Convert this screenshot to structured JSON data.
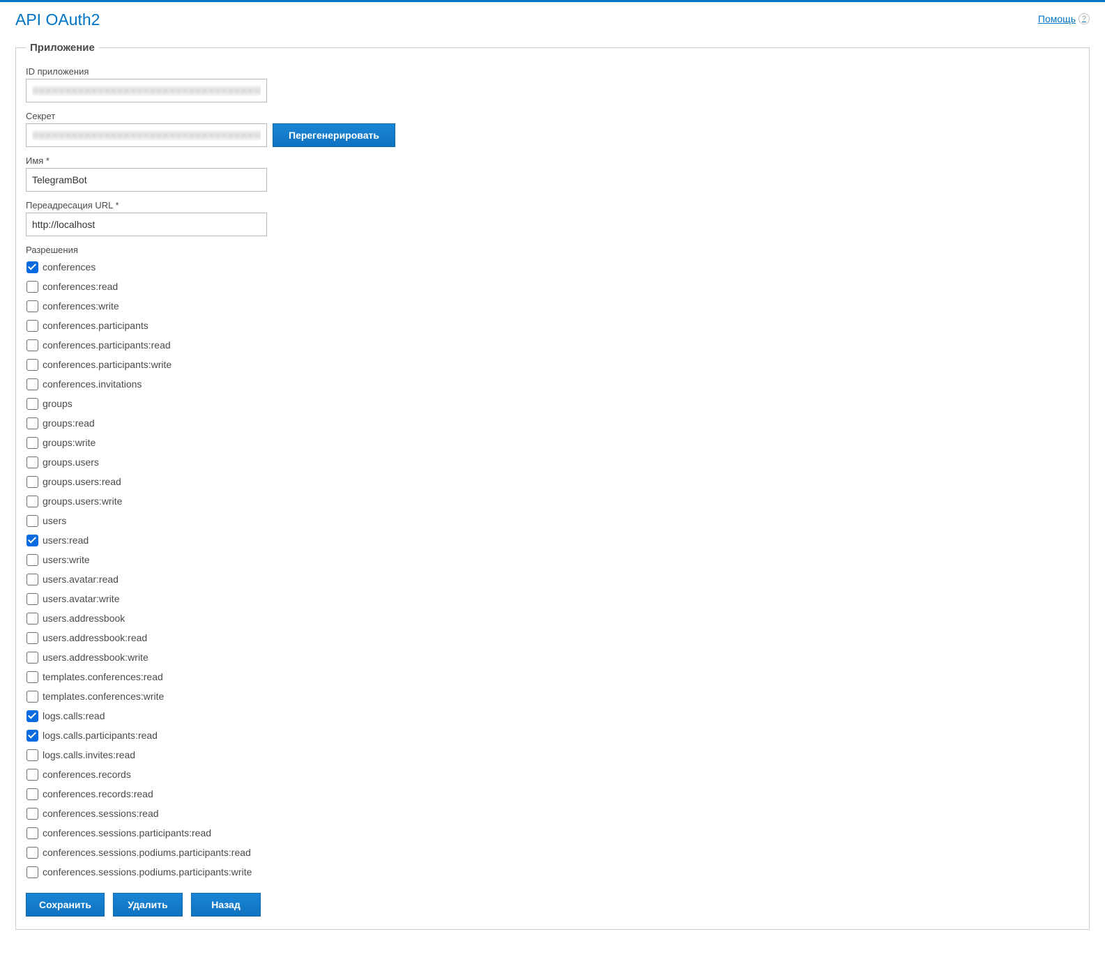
{
  "header": {
    "title": "API OAuth2",
    "help_label": "Помощь"
  },
  "fieldset_legend": "Приложение",
  "fields": {
    "app_id": {
      "label": "ID приложения",
      "value": "XXXXXXXXXXXXXXXXXXXXXXXXXXXXXXXXXXXXXX"
    },
    "secret": {
      "label": "Секрет",
      "value": "XXXXXXXXXXXXXXXXXXXXXXXXXXXXXXXXXXXXXX",
      "regenerate_label": "Перегенерировать"
    },
    "name": {
      "label": "Имя *",
      "value": "TelegramBot"
    },
    "redirect": {
      "label": "Переадресация URL *",
      "value": "http://localhost"
    }
  },
  "permissions_label": "Разрешения",
  "permissions": [
    {
      "name": "conferences",
      "checked": true
    },
    {
      "name": "conferences:read",
      "checked": false
    },
    {
      "name": "conferences:write",
      "checked": false
    },
    {
      "name": "conferences.participants",
      "checked": false
    },
    {
      "name": "conferences.participants:read",
      "checked": false
    },
    {
      "name": "conferences.participants:write",
      "checked": false
    },
    {
      "name": "conferences.invitations",
      "checked": false
    },
    {
      "name": "groups",
      "checked": false
    },
    {
      "name": "groups:read",
      "checked": false
    },
    {
      "name": "groups:write",
      "checked": false
    },
    {
      "name": "groups.users",
      "checked": false
    },
    {
      "name": "groups.users:read",
      "checked": false
    },
    {
      "name": "groups.users:write",
      "checked": false
    },
    {
      "name": "users",
      "checked": false
    },
    {
      "name": "users:read",
      "checked": true
    },
    {
      "name": "users:write",
      "checked": false
    },
    {
      "name": "users.avatar:read",
      "checked": false
    },
    {
      "name": "users.avatar:write",
      "checked": false
    },
    {
      "name": "users.addressbook",
      "checked": false
    },
    {
      "name": "users.addressbook:read",
      "checked": false
    },
    {
      "name": "users.addressbook:write",
      "checked": false
    },
    {
      "name": "templates.conferences:read",
      "checked": false
    },
    {
      "name": "templates.conferences:write",
      "checked": false
    },
    {
      "name": "logs.calls:read",
      "checked": true
    },
    {
      "name": "logs.calls.participants:read",
      "checked": true
    },
    {
      "name": "logs.calls.invites:read",
      "checked": false
    },
    {
      "name": "conferences.records",
      "checked": false
    },
    {
      "name": "conferences.records:read",
      "checked": false
    },
    {
      "name": "conferences.sessions:read",
      "checked": false
    },
    {
      "name": "conferences.sessions.participants:read",
      "checked": false
    },
    {
      "name": "conferences.sessions.podiums.participants:read",
      "checked": false
    },
    {
      "name": "conferences.sessions.podiums.participants:write",
      "checked": false
    }
  ],
  "buttons": {
    "save": "Сохранить",
    "delete": "Удалить",
    "back": "Назад"
  }
}
